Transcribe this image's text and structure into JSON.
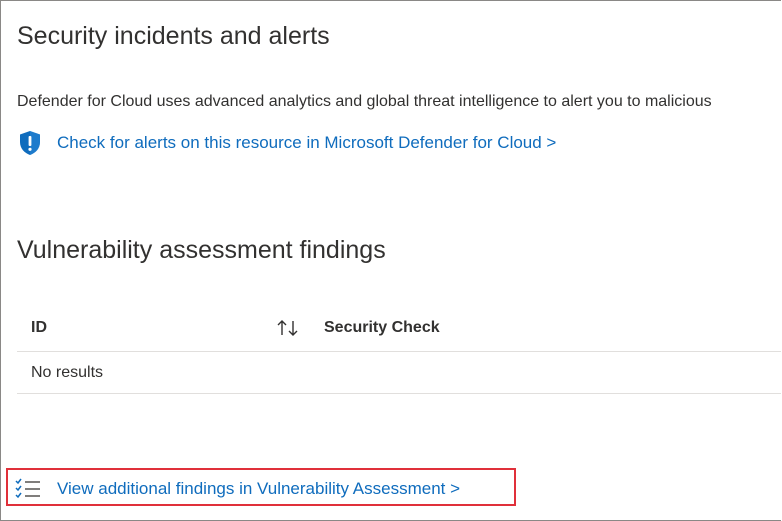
{
  "security_section": {
    "title": "Security incidents and alerts",
    "description": "Defender for Cloud uses advanced analytics and global threat intelligence to alert you to malicious",
    "alerts_link": "Check for alerts on this resource in Microsoft Defender for Cloud >",
    "shield_icon": "shield-alert-icon"
  },
  "vulnerability_section": {
    "title": "Vulnerability assessment findings",
    "table": {
      "columns": [
        "ID",
        "Security Check"
      ],
      "sort_icon": "sort-up-down-icon",
      "empty_message": "No results"
    },
    "findings_link": "View additional findings in Vulnerability Assessment >",
    "checklist_icon": "checklist-icon"
  },
  "colors": {
    "link": "#0f6cbd",
    "highlight": "#e0303a",
    "shield": "#0f6cbd"
  }
}
